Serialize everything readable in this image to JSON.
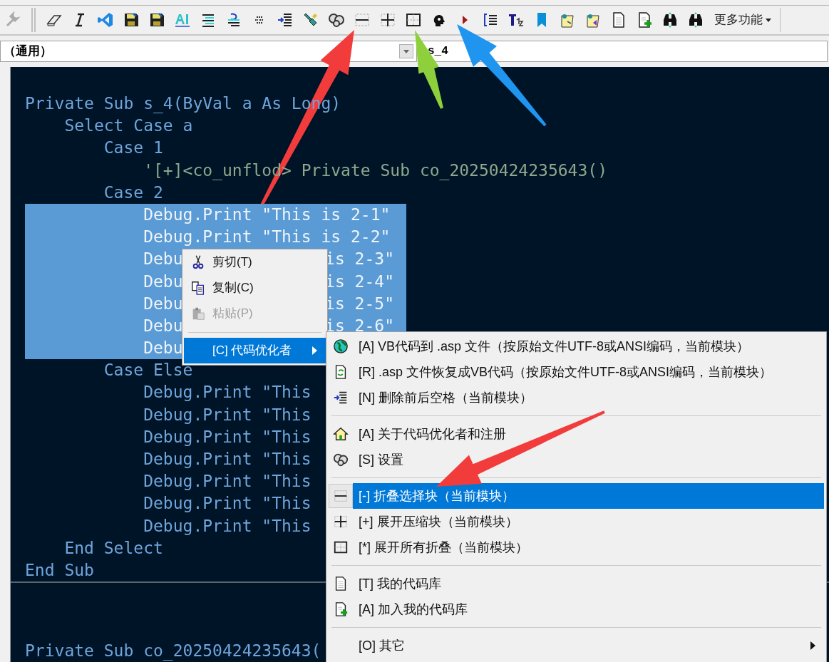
{
  "toolbar": {
    "more_button": "更多功能"
  },
  "object_combo": {
    "value": "（通用）"
  },
  "procedure_combo": {
    "value": "s_4"
  },
  "procedures": [
    {
      "lines": [
        {
          "text": "Private Sub s_4(ByVal a As Long)",
          "kind": "code",
          "selected": false
        },
        {
          "text": "    Select Case a",
          "kind": "code",
          "selected": false
        },
        {
          "text": "        Case 1",
          "kind": "code",
          "selected": false
        },
        {
          "text": "            '[+]<co_unflod> Private Sub co_20250424235643()",
          "kind": "comment",
          "selected": false
        },
        {
          "text": "        Case 2",
          "kind": "code",
          "selected": false
        },
        {
          "text": "            Debug.Print \"This is 2-1\"",
          "kind": "code",
          "selected": true
        },
        {
          "text": "            Debug.Print \"This is 2-2\"",
          "kind": "code",
          "selected": true
        },
        {
          "text": "            Debu",
          "tail": "is 2-3\"",
          "kind": "code",
          "selected": true
        },
        {
          "text": "            Debu",
          "tail": "is 2-4\"",
          "kind": "code",
          "selected": true
        },
        {
          "text": "            Debu",
          "tail": "is 2-5\"",
          "kind": "code",
          "selected": true
        },
        {
          "text": "            Debu",
          "tail": "is 2-6\"",
          "kind": "code",
          "selected": true
        },
        {
          "text": "            Debu",
          "kind": "code",
          "selected": true
        },
        {
          "text": "        Case Else",
          "kind": "code",
          "selected": false
        },
        {
          "text": "            Debug.Print \"This",
          "kind": "code",
          "selected": false
        },
        {
          "text": "            Debug.Print \"This",
          "kind": "code",
          "selected": false
        },
        {
          "text": "            Debug.Print \"This",
          "kind": "code",
          "selected": false
        },
        {
          "text": "            Debug.Print \"This",
          "kind": "code",
          "selected": false
        },
        {
          "text": "            Debug.Print \"This",
          "kind": "code",
          "selected": false
        },
        {
          "text": "            Debug.Print \"This",
          "kind": "code",
          "selected": false
        },
        {
          "text": "            Debug.Print \"This",
          "kind": "code",
          "selected": false
        },
        {
          "text": "    End Select",
          "kind": "code",
          "selected": false
        },
        {
          "text": "End Sub",
          "kind": "code",
          "selected": false
        }
      ]
    },
    {
      "lines": [
        {
          "text": "Private Sub co_20250424235643(",
          "kind": "code",
          "selected": false
        }
      ]
    }
  ],
  "context_menu": {
    "items": [
      {
        "kind": "item",
        "label": "剪切(T)",
        "disabled": false,
        "selected": false
      },
      {
        "kind": "item",
        "label": "复制(C)",
        "disabled": false,
        "selected": false
      },
      {
        "kind": "item",
        "label": "粘贴(P)",
        "disabled": true,
        "selected": false
      },
      {
        "kind": "separator"
      },
      {
        "kind": "submenu",
        "label": "[C] 代码优化者",
        "disabled": false,
        "selected": true
      }
    ]
  },
  "submenu": {
    "items": [
      {
        "kind": "item",
        "label": "[A] VB代码到 .asp 文件（按原始文件UTF-8或ANSI编码，当前模块）",
        "selected": false
      },
      {
        "kind": "item",
        "label": "[R] .asp 文件恢复成VB代码（按原始文件UTF-8或ANSI编码，当前模块）",
        "selected": false
      },
      {
        "kind": "item",
        "label": "[N] 删除前后空格（当前模块）",
        "selected": false
      },
      {
        "kind": "separator"
      },
      {
        "kind": "item",
        "label": "[A] 关于代码优化者和注册",
        "selected": false
      },
      {
        "kind": "item",
        "label": "[S] 设置",
        "selected": false
      },
      {
        "kind": "separator"
      },
      {
        "kind": "item",
        "label": "[-] 折叠选择块（当前模块）",
        "selected": true
      },
      {
        "kind": "item",
        "label": "[+] 展开压缩块（当前模块）",
        "selected": false
      },
      {
        "kind": "item",
        "label": "[*] 展开所有折叠（当前模块）",
        "selected": false
      },
      {
        "kind": "separator"
      },
      {
        "kind": "item",
        "label": "[T] 我的代码库",
        "selected": false
      },
      {
        "kind": "item",
        "label": "[A] 加入我的代码库",
        "selected": false
      },
      {
        "kind": "separator"
      },
      {
        "kind": "submenu",
        "label": "[O] 其它",
        "selected": false
      }
    ]
  }
}
